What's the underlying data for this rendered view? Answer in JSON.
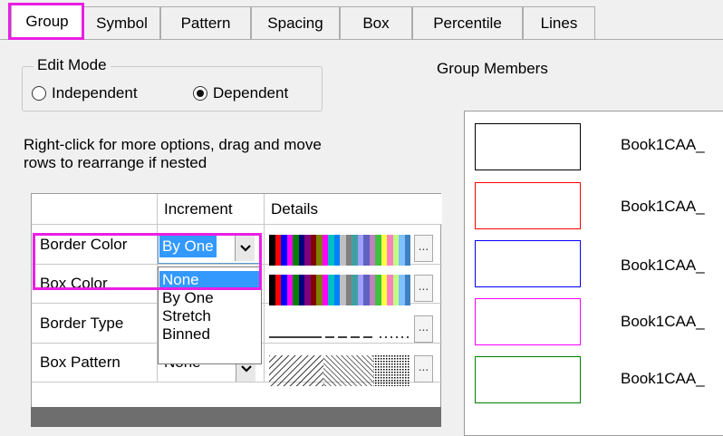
{
  "tabs": [
    {
      "label": "Group",
      "active": true
    },
    {
      "label": "Symbol"
    },
    {
      "label": "Pattern"
    },
    {
      "label": "Spacing"
    },
    {
      "label": "Box"
    },
    {
      "label": "Percentile"
    },
    {
      "label": "Lines"
    }
  ],
  "edit_mode": {
    "title": "Edit Mode",
    "options": [
      {
        "label": "Independent",
        "selected": false
      },
      {
        "label": "Dependent",
        "selected": true
      }
    ]
  },
  "hint": {
    "line1": "Right-click for more options, drag and move",
    "line2": "rows to  rearrange if nested"
  },
  "group_members_label": "Group Members",
  "grid": {
    "headers": {
      "increment": "Increment",
      "details": "Details"
    },
    "rows": [
      {
        "name": "Border Color",
        "increment": "By One",
        "details": "colors"
      },
      {
        "name": "Box Color",
        "increment": "",
        "details": "colors"
      },
      {
        "name": "Border Type",
        "increment": "",
        "details": "lines"
      },
      {
        "name": "Box Pattern",
        "increment": "None",
        "details": "patterns"
      }
    ],
    "more_button": "...",
    "dropdown_options": [
      "None",
      "By One",
      "Stretch",
      "Binned"
    ],
    "dropdown_selected": "None"
  },
  "palette": [
    "#000000",
    "#ff0000",
    "#0000ff",
    "#ff00ff",
    "#008000",
    "#000080",
    "#800080",
    "#800000",
    "#808000",
    "#ff00ff",
    "#00c0c0",
    "#0080ff",
    "#c0c0c0",
    "#808080",
    "#40a0a0",
    "#a0a0ff",
    "#6060c0",
    "#c080c0",
    "#40c040",
    "#ffff40",
    "#ff80c0",
    "#c0ff80",
    "#80c0ff",
    "#4080c0"
  ],
  "members": [
    {
      "label": "Book1CAA_",
      "color": "#000000"
    },
    {
      "label": "Book1CAA_",
      "color": "#ff0000"
    },
    {
      "label": "Book1CAA_",
      "color": "#0000ff"
    },
    {
      "label": "Book1CAA_",
      "color": "#ff00ff"
    },
    {
      "label": "Book1CAA_",
      "color": "#008000"
    }
  ],
  "highlight_color": "#ea1ee4"
}
